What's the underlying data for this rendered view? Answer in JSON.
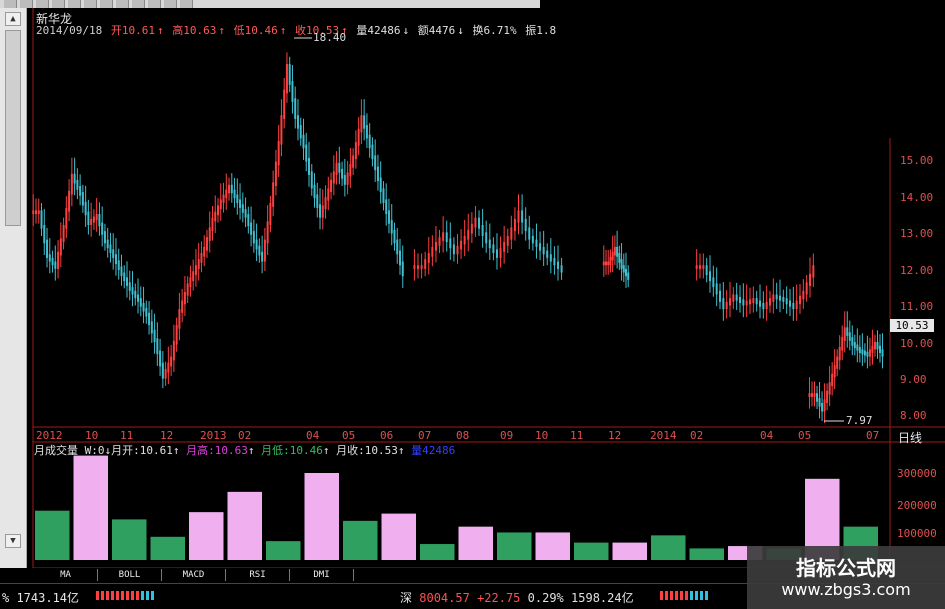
{
  "stock": {
    "name": "新华龙"
  },
  "info_bar": {
    "date": "2014/09/18",
    "open": "开10.61",
    "high": "高10.63",
    "low": "低10.46",
    "close": "收10.53",
    "volume": "量42486",
    "amount": "额4476",
    "turnover": "换6.71%",
    "amplitude": "振1.8",
    "up_arrow": "↑",
    "down_arrow": "↓"
  },
  "price_axis": [
    "15.00",
    "14.00",
    "13.00",
    "12.00",
    "11.00",
    "10.00",
    "9.00",
    "8.00"
  ],
  "current_price": "10.53",
  "annotations": {
    "peak": "18.40",
    "trough": "7.97"
  },
  "date_axis": [
    "2012",
    "10",
    "11",
    "12",
    "2013",
    "02",
    "04",
    "05",
    "06",
    "07",
    "08",
    "09",
    "10",
    "11",
    "12",
    "2014",
    "02",
    "04",
    "05",
    "07"
  ],
  "period": "日线",
  "volume_info": {
    "label": "月成交量",
    "w": "W:0",
    "month_open": "月开:10.61",
    "month_high": "月高:10.63",
    "month_low": "月低:10.46",
    "month_close": "月收:10.53",
    "vol": "量",
    "vol_value": "42486"
  },
  "volume_axis": [
    "300000",
    "200000",
    "100000"
  ],
  "tabs": [
    "MA",
    "BOLL",
    "MACD",
    "RSI",
    "DMI"
  ],
  "status": {
    "left_amount": "% 1743.14亿",
    "market": "深",
    "index": "8004.57",
    "change": "+22.75",
    "pct": "0.29%",
    "turnover": "1598.24亿"
  },
  "watermark": {
    "title": "指标公式网",
    "url": "www.zbgs3.com"
  },
  "colors": {
    "up": "#ff4040",
    "down": "#40c0d0",
    "vol_up": "#f0b0f0",
    "vol_down": "#30a060",
    "frame": "#9b1b1b"
  },
  "candle_series": {
    "segments": [
      {
        "prices": [
          13.6,
          12.4,
          12.1,
          13.2,
          14.6,
          14.1,
          13.3,
          13.5,
          12.8,
          12.4,
          11.9,
          11.5,
          11.2,
          10.8,
          10.1,
          9.1,
          9.6,
          10.9,
          11.6,
          12.1,
          12.6,
          13.4,
          13.9,
          14.3,
          13.9,
          13.5,
          12.8,
          12.3,
          13.8,
          15.5,
          17.6,
          16.2,
          15.4,
          14.3,
          13.5,
          14.2,
          14.9,
          14.4,
          15.1,
          16.2,
          15.4,
          14.5,
          13.6,
          12.8,
          11.9
        ]
      },
      {
        "prices": [
          12.1,
          12.6,
          13.0,
          12.5,
          12.9,
          13.4,
          12.8,
          12.4,
          12.9,
          13.6,
          12.9,
          12.6,
          12.3,
          12.0
        ]
      },
      {
        "prices": [
          12.2,
          12.6,
          12.1,
          11.8
        ]
      },
      {
        "prices": [
          12.1,
          11.6,
          11.0,
          11.3,
          11.1,
          11.2,
          11.0,
          11.3,
          11.2,
          11.0,
          11.4,
          12.1
        ]
      },
      {
        "prices": [
          8.6,
          8.2,
          8.9,
          9.6,
          10.4,
          10.0,
          9.8,
          9.7,
          10.0,
          9.7
        ]
      }
    ]
  },
  "volume_bars": [
    {
      "value": 170000,
      "up": false
    },
    {
      "value": 360000,
      "up": true
    },
    {
      "value": 140000,
      "up": false
    },
    {
      "value": 80000,
      "up": false
    },
    {
      "value": 165000,
      "up": true
    },
    {
      "value": 235000,
      "up": true
    },
    {
      "value": 65000,
      "up": false
    },
    {
      "value": 300000,
      "up": true
    },
    {
      "value": 135000,
      "up": false
    },
    {
      "value": 160000,
      "up": true
    },
    {
      "value": 55000,
      "up": false
    },
    {
      "value": 115000,
      "up": true
    },
    {
      "value": 95000,
      "up": false
    },
    {
      "value": 95000,
      "up": true
    },
    {
      "value": 60000,
      "up": false
    },
    {
      "value": 60000,
      "up": true
    },
    {
      "value": 85000,
      "up": false
    },
    {
      "value": 40000,
      "up": false
    },
    {
      "value": 48000,
      "up": true
    },
    {
      "value": 40000,
      "up": false
    },
    {
      "value": 280000,
      "up": true
    },
    {
      "value": 115000,
      "up": false
    }
  ]
}
